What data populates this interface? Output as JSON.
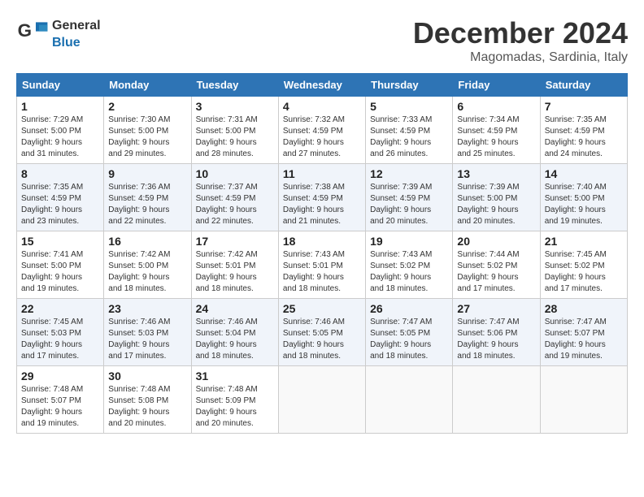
{
  "header": {
    "logo_general": "General",
    "logo_blue": "Blue",
    "month_title": "December 2024",
    "location": "Magomadas, Sardinia, Italy"
  },
  "weekdays": [
    "Sunday",
    "Monday",
    "Tuesday",
    "Wednesday",
    "Thursday",
    "Friday",
    "Saturday"
  ],
  "weeks": [
    [
      {
        "day": "1",
        "info": "Sunrise: 7:29 AM\nSunset: 5:00 PM\nDaylight: 9 hours\nand 31 minutes."
      },
      {
        "day": "2",
        "info": "Sunrise: 7:30 AM\nSunset: 5:00 PM\nDaylight: 9 hours\nand 29 minutes."
      },
      {
        "day": "3",
        "info": "Sunrise: 7:31 AM\nSunset: 5:00 PM\nDaylight: 9 hours\nand 28 minutes."
      },
      {
        "day": "4",
        "info": "Sunrise: 7:32 AM\nSunset: 4:59 PM\nDaylight: 9 hours\nand 27 minutes."
      },
      {
        "day": "5",
        "info": "Sunrise: 7:33 AM\nSunset: 4:59 PM\nDaylight: 9 hours\nand 26 minutes."
      },
      {
        "day": "6",
        "info": "Sunrise: 7:34 AM\nSunset: 4:59 PM\nDaylight: 9 hours\nand 25 minutes."
      },
      {
        "day": "7",
        "info": "Sunrise: 7:35 AM\nSunset: 4:59 PM\nDaylight: 9 hours\nand 24 minutes."
      }
    ],
    [
      {
        "day": "8",
        "info": "Sunrise: 7:35 AM\nSunset: 4:59 PM\nDaylight: 9 hours\nand 23 minutes."
      },
      {
        "day": "9",
        "info": "Sunrise: 7:36 AM\nSunset: 4:59 PM\nDaylight: 9 hours\nand 22 minutes."
      },
      {
        "day": "10",
        "info": "Sunrise: 7:37 AM\nSunset: 4:59 PM\nDaylight: 9 hours\nand 22 minutes."
      },
      {
        "day": "11",
        "info": "Sunrise: 7:38 AM\nSunset: 4:59 PM\nDaylight: 9 hours\nand 21 minutes."
      },
      {
        "day": "12",
        "info": "Sunrise: 7:39 AM\nSunset: 4:59 PM\nDaylight: 9 hours\nand 20 minutes."
      },
      {
        "day": "13",
        "info": "Sunrise: 7:39 AM\nSunset: 5:00 PM\nDaylight: 9 hours\nand 20 minutes."
      },
      {
        "day": "14",
        "info": "Sunrise: 7:40 AM\nSunset: 5:00 PM\nDaylight: 9 hours\nand 19 minutes."
      }
    ],
    [
      {
        "day": "15",
        "info": "Sunrise: 7:41 AM\nSunset: 5:00 PM\nDaylight: 9 hours\nand 19 minutes."
      },
      {
        "day": "16",
        "info": "Sunrise: 7:42 AM\nSunset: 5:00 PM\nDaylight: 9 hours\nand 18 minutes."
      },
      {
        "day": "17",
        "info": "Sunrise: 7:42 AM\nSunset: 5:01 PM\nDaylight: 9 hours\nand 18 minutes."
      },
      {
        "day": "18",
        "info": "Sunrise: 7:43 AM\nSunset: 5:01 PM\nDaylight: 9 hours\nand 18 minutes."
      },
      {
        "day": "19",
        "info": "Sunrise: 7:43 AM\nSunset: 5:02 PM\nDaylight: 9 hours\nand 18 minutes."
      },
      {
        "day": "20",
        "info": "Sunrise: 7:44 AM\nSunset: 5:02 PM\nDaylight: 9 hours\nand 17 minutes."
      },
      {
        "day": "21",
        "info": "Sunrise: 7:45 AM\nSunset: 5:02 PM\nDaylight: 9 hours\nand 17 minutes."
      }
    ],
    [
      {
        "day": "22",
        "info": "Sunrise: 7:45 AM\nSunset: 5:03 PM\nDaylight: 9 hours\nand 17 minutes."
      },
      {
        "day": "23",
        "info": "Sunrise: 7:46 AM\nSunset: 5:03 PM\nDaylight: 9 hours\nand 17 minutes."
      },
      {
        "day": "24",
        "info": "Sunrise: 7:46 AM\nSunset: 5:04 PM\nDaylight: 9 hours\nand 18 minutes."
      },
      {
        "day": "25",
        "info": "Sunrise: 7:46 AM\nSunset: 5:05 PM\nDaylight: 9 hours\nand 18 minutes."
      },
      {
        "day": "26",
        "info": "Sunrise: 7:47 AM\nSunset: 5:05 PM\nDaylight: 9 hours\nand 18 minutes."
      },
      {
        "day": "27",
        "info": "Sunrise: 7:47 AM\nSunset: 5:06 PM\nDaylight: 9 hours\nand 18 minutes."
      },
      {
        "day": "28",
        "info": "Sunrise: 7:47 AM\nSunset: 5:07 PM\nDaylight: 9 hours\nand 19 minutes."
      }
    ],
    [
      {
        "day": "29",
        "info": "Sunrise: 7:48 AM\nSunset: 5:07 PM\nDaylight: 9 hours\nand 19 minutes."
      },
      {
        "day": "30",
        "info": "Sunrise: 7:48 AM\nSunset: 5:08 PM\nDaylight: 9 hours\nand 20 minutes."
      },
      {
        "day": "31",
        "info": "Sunrise: 7:48 AM\nSunset: 5:09 PM\nDaylight: 9 hours\nand 20 minutes."
      },
      {
        "day": "",
        "info": ""
      },
      {
        "day": "",
        "info": ""
      },
      {
        "day": "",
        "info": ""
      },
      {
        "day": "",
        "info": ""
      }
    ]
  ]
}
